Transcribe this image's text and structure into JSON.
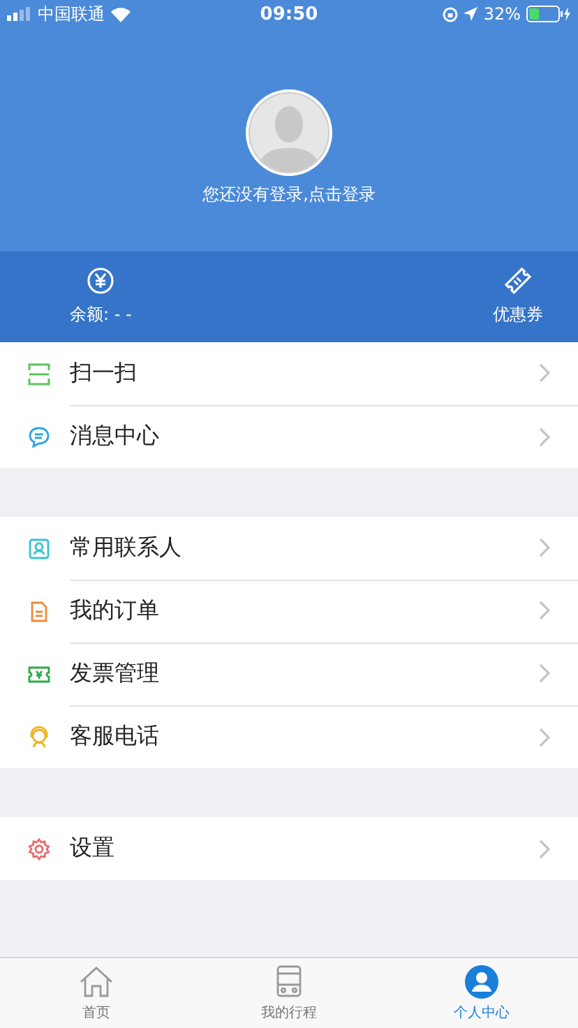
{
  "status_bar": {
    "carrier": "中国联通",
    "time": "09:50",
    "battery": "32%"
  },
  "profile": {
    "login_prompt": "您还没有登录,点击登录"
  },
  "wallet": [
    {
      "kind": "balance",
      "label": "余额: - -"
    },
    {
      "kind": "coupon",
      "label": "优惠券"
    }
  ],
  "menu_groups": [
    [
      {
        "kind": "scan",
        "label": "扫一扫"
      },
      {
        "kind": "message",
        "label": "消息中心"
      }
    ],
    [
      {
        "kind": "contacts",
        "label": "常用联系人"
      },
      {
        "kind": "orders",
        "label": "我的订单"
      },
      {
        "kind": "invoice",
        "label": "发票管理"
      },
      {
        "kind": "service",
        "label": "客服电话"
      }
    ],
    [
      {
        "kind": "settings",
        "label": "设置"
      }
    ]
  ],
  "tab_bar": [
    {
      "kind": "home",
      "label": "首页",
      "selected": false
    },
    {
      "kind": "trips",
      "label": "我的行程",
      "selected": false
    },
    {
      "kind": "profile",
      "label": "个人中心",
      "selected": true
    }
  ]
}
